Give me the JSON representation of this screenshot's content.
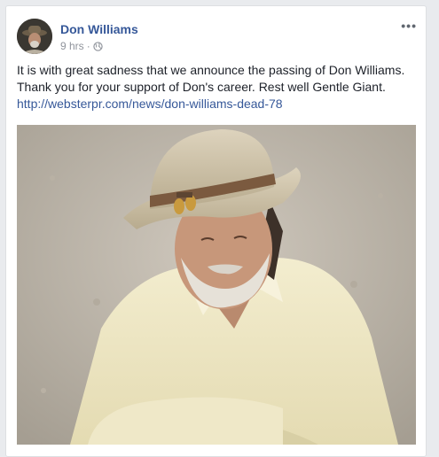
{
  "post": {
    "author": "Don Williams",
    "time": "9 hrs",
    "separator": "·",
    "privacy_icon": "globe-icon",
    "more_icon": "more-options-icon",
    "more_label": "•••",
    "text_line1": "It is with great sadness that we announce the passing of Don Williams.",
    "text_line2": "Thank you for your support of Don's career. Rest well Gentle Giant.",
    "link": "http://websterpr.com/news/don-williams-dead-78"
  },
  "colors": {
    "author": "#365899",
    "link": "#365899",
    "meta": "#90949c",
    "background": "#e9ebee"
  }
}
